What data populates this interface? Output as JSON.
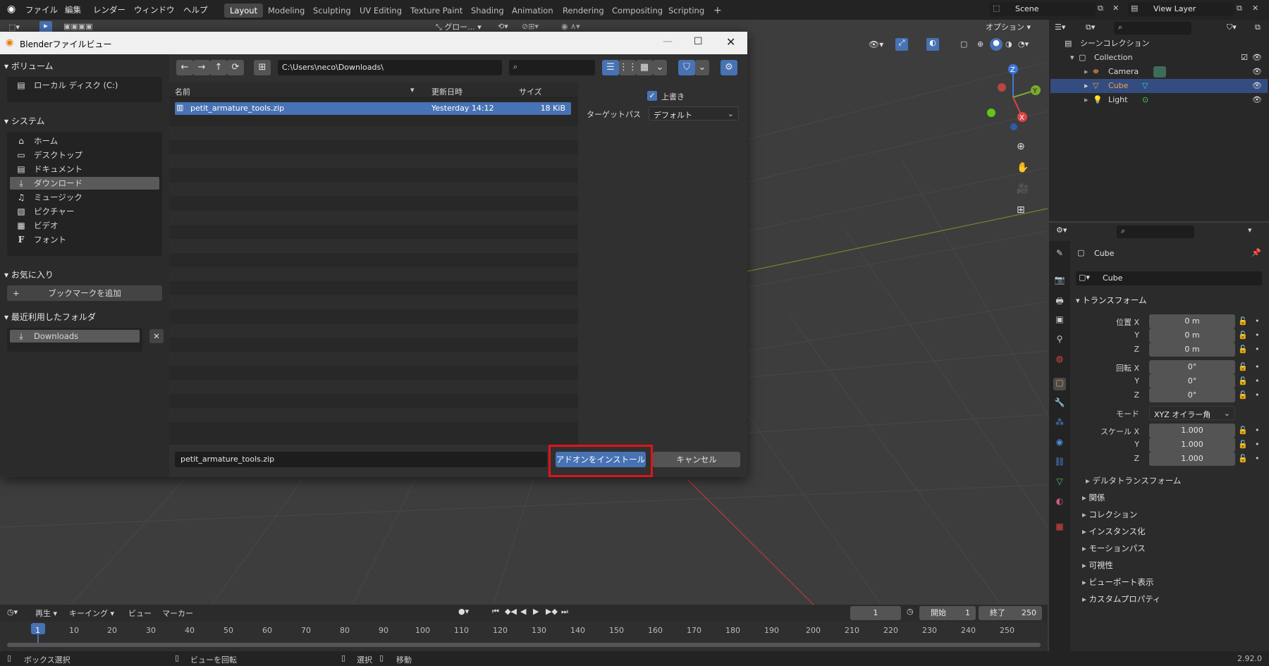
{
  "app": {
    "menu": [
      "ファイル",
      "編集",
      "レンダー",
      "ウィンドウ",
      "ヘルプ"
    ],
    "workspaces": [
      "Layout",
      "Modeling",
      "Sculpting",
      "UV Editing",
      "Texture Paint",
      "Shading",
      "Animation",
      "Rendering",
      "Compositing",
      "Scripting"
    ],
    "active_workspace": "Layout",
    "scene": "Scene",
    "view_layer": "View Layer",
    "options_label": "オプション",
    "global_label": "グロー...",
    "version": "2.92.0"
  },
  "dialog": {
    "title": "Blenderファイルビュー",
    "path": "C:\\Users\\neco\\Downloads\\",
    "search_placeholder": "",
    "volumes": {
      "header": "ボリューム",
      "items": [
        "ローカル ディスク (C:)"
      ]
    },
    "system": {
      "header": "システム",
      "items": [
        "ホーム",
        "デスクトップ",
        "ドキュメント",
        "ダウンロード",
        "ミュージック",
        "ピクチャー",
        "ビデオ",
        "フォント"
      ],
      "selected": "ダウンロード"
    },
    "favorites": {
      "header": "お気に入り",
      "add_bookmark": "ブックマークを追加"
    },
    "recent": {
      "header": "最近利用したフォルダ",
      "items": [
        "Downloads"
      ]
    },
    "columns": [
      "名前",
      "更新日時",
      "サイズ"
    ],
    "files": [
      {
        "name": "petit_armature_tools.zip",
        "date": "Yesterday 14:12",
        "size": "18 KiB",
        "selected": true
      }
    ],
    "options": {
      "overwrite_label": "上書き",
      "overwrite_checked": true,
      "target_path_label": "ターゲットパス",
      "target_path_value": "デフォルト"
    },
    "filename": "petit_armature_tools.zip",
    "install_button": "アドオンをインストール",
    "cancel_button": "キャンセル",
    "highlight_color": "#e0141b"
  },
  "outliner": {
    "root": "シーンコレクション",
    "collection": "Collection",
    "items": [
      "Camera",
      "Cube",
      "Light"
    ],
    "selected": "Cube"
  },
  "properties": {
    "object_name": "Cube",
    "data_name": "Cube",
    "transform_header": "トランスフォーム",
    "location_label": "位置 X",
    "rotation_label": "回転 X",
    "scale_label": "スケール X",
    "axis_y": "Y",
    "axis_z": "Z",
    "location": [
      "0 m",
      "0 m",
      "0 m"
    ],
    "rotation": [
      "0°",
      "0°",
      "0°"
    ],
    "mode_label": "モード",
    "mode_value": "XYZ オイラー角",
    "scale": [
      "1.000",
      "1.000",
      "1.000"
    ],
    "delta_transform": "デルタトランスフォーム",
    "sections": [
      "関係",
      "コレクション",
      "インスタンス化",
      "モーションパス",
      "可視性",
      "ビューポート表示",
      "カスタムプロパティ"
    ]
  },
  "timeline": {
    "playback": "再生",
    "keying": "キーイング",
    "view": "ビュー",
    "marker": "マーカー",
    "current_frame": "1",
    "start_label": "開始",
    "start": "1",
    "end_label": "終了",
    "end": "250",
    "ticks": [
      "1",
      "10",
      "20",
      "30",
      "40",
      "50",
      "60",
      "70",
      "80",
      "90",
      "100",
      "110",
      "120",
      "130",
      "140",
      "150",
      "160",
      "170",
      "180",
      "190",
      "200",
      "210",
      "220",
      "230",
      "240",
      "250"
    ]
  },
  "status": {
    "box_select": "ボックス選択",
    "rotate_view": "ビューを回転",
    "select": "選択",
    "move": "移動"
  }
}
